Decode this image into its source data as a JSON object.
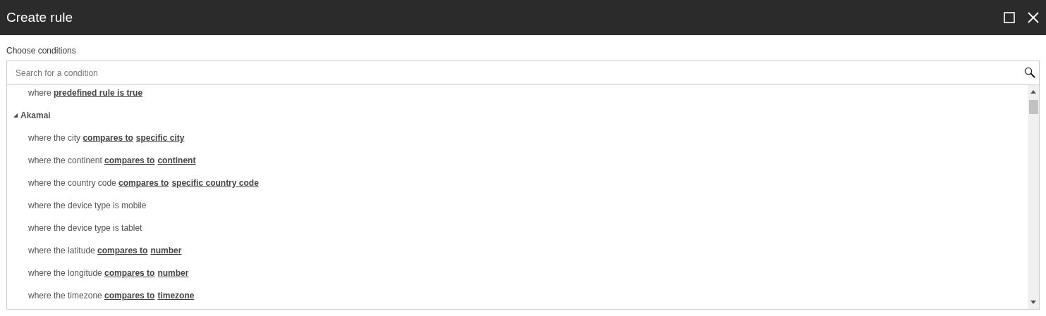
{
  "window": {
    "title": "Create rule"
  },
  "conditions_label": "Choose conditions",
  "search": {
    "placeholder": "Search for a condition"
  },
  "tree": [
    {
      "kind": "condition",
      "parts": [
        {
          "kind": "text",
          "text": "where "
        },
        {
          "kind": "link",
          "text": "predefined rule is true"
        }
      ]
    },
    {
      "kind": "group",
      "label": "Akamai",
      "expanded": true,
      "children": [
        {
          "kind": "condition",
          "parts": [
            {
              "kind": "text",
              "text": "where the city "
            },
            {
              "kind": "link",
              "text": "compares to"
            },
            {
              "kind": "link",
              "text": "specific city"
            }
          ]
        },
        {
          "kind": "condition",
          "parts": [
            {
              "kind": "text",
              "text": "where the continent "
            },
            {
              "kind": "link",
              "text": "compares to"
            },
            {
              "kind": "link",
              "text": "continent"
            }
          ]
        },
        {
          "kind": "condition",
          "parts": [
            {
              "kind": "text",
              "text": "where the country code "
            },
            {
              "kind": "link",
              "text": "compares to"
            },
            {
              "kind": "link",
              "text": "specific country code"
            }
          ]
        },
        {
          "kind": "condition",
          "parts": [
            {
              "kind": "text",
              "text": "where the device type is mobile"
            }
          ]
        },
        {
          "kind": "condition",
          "parts": [
            {
              "kind": "text",
              "text": "where the device type is tablet"
            }
          ]
        },
        {
          "kind": "condition",
          "parts": [
            {
              "kind": "text",
              "text": "where the latitude "
            },
            {
              "kind": "link",
              "text": "compares to"
            },
            {
              "kind": "link",
              "text": "number"
            }
          ]
        },
        {
          "kind": "condition",
          "parts": [
            {
              "kind": "text",
              "text": "where the longitude "
            },
            {
              "kind": "link",
              "text": "compares to"
            },
            {
              "kind": "link",
              "text": "number"
            }
          ]
        },
        {
          "kind": "condition",
          "parts": [
            {
              "kind": "text",
              "text": "where the timezone "
            },
            {
              "kind": "link",
              "text": "compares to"
            },
            {
              "kind": "link",
              "text": "timezone"
            }
          ]
        }
      ]
    }
  ]
}
